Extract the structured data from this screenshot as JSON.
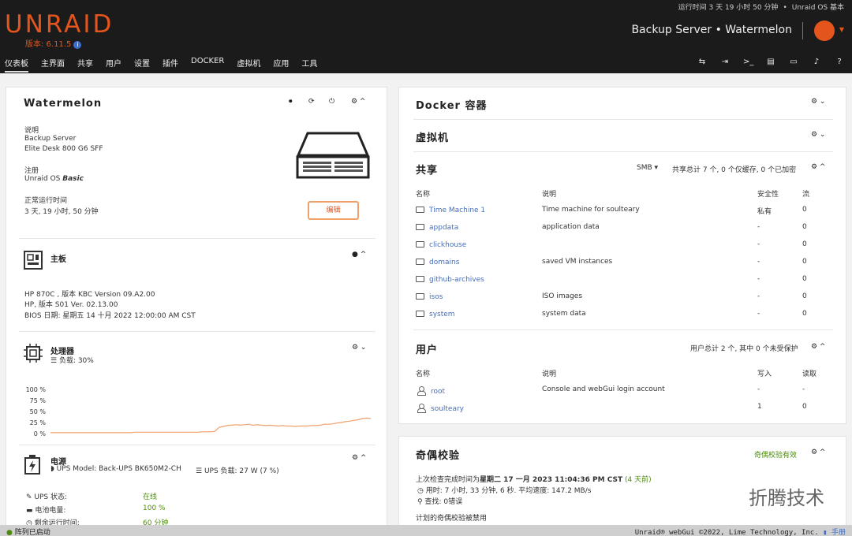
{
  "header": {
    "logo": "UNRAID",
    "version": "版本: 6.11.5",
    "uptime_top": "运行时间 3 天 19 小时 50 分钟",
    "license_top": "Unraid OS 基本",
    "server_title": "Backup Server • Watermelon"
  },
  "nav": {
    "items": [
      "仪表板",
      "主界面",
      "共享",
      "用户",
      "设置",
      "插件",
      "DOCKER",
      "虚拟机",
      "应用",
      "工具"
    ]
  },
  "server_panel": {
    "title": "Watermelon",
    "desc_label": "说明",
    "desc_line1": "Backup Server",
    "desc_line2": "Elite Desk 800 G6 SFF",
    "reg_label": "注册",
    "reg_value_prefix": "Unraid OS ",
    "reg_value_em": "Basic",
    "uptime_label": "正常运行时间",
    "uptime_value": "3 天, 19 小时, 50 分钟",
    "edit_button": "编辑"
  },
  "motherboard": {
    "title": "主板",
    "line1": "HP 870C , 版本 KBC Version 09.A2.00",
    "line2": "HP, 版本 S01 Ver. 02.13.00",
    "line3": "BIOS 日期: 星期五 14 十月 2022 12:00:00 AM CST"
  },
  "cpu": {
    "title": "处理器",
    "load": "负载: 30%",
    "ticks": [
      "100 %",
      "75 %",
      "50 %",
      "25 %",
      "0 %"
    ]
  },
  "chart_data": {
    "type": "line",
    "title": "",
    "ylim": [
      0,
      100
    ],
    "ticks": [
      0,
      25,
      50,
      75,
      100
    ],
    "series": [
      {
        "values": [
          2,
          2,
          2,
          2,
          2,
          2,
          2,
          2,
          2,
          2,
          2,
          2,
          2,
          2,
          2,
          2,
          2,
          2,
          2,
          2,
          3,
          3,
          3,
          3,
          3,
          3,
          3,
          3,
          3,
          3,
          3,
          3,
          3,
          3,
          3,
          3,
          4,
          4,
          4,
          5,
          14,
          16,
          18,
          19,
          20,
          19,
          20,
          21,
          19,
          20,
          19,
          18,
          19,
          18,
          17,
          18,
          17,
          17,
          16,
          17,
          17,
          17,
          18,
          18,
          19,
          21,
          21,
          22,
          24,
          25,
          27,
          28,
          30,
          31,
          34,
          35,
          34
        ]
      }
    ],
    "color": "#f0a06a",
    "grid": false
  },
  "power": {
    "title": "电源",
    "ups_model": "UPS Model: Back-UPS BK650M2-CH",
    "ups_load": "UPS 负载: 27 W (7 %)",
    "rows": [
      {
        "label": "UPS 状态:",
        "value": "在线"
      },
      {
        "label": "电池电量:",
        "value": "100 %"
      },
      {
        "label": "剩余运行时间:",
        "value": "60 分钟"
      }
    ]
  },
  "docker": {
    "title": "Docker 容器"
  },
  "vms": {
    "title": "虚拟机"
  },
  "shares": {
    "title": "共享",
    "filter": "SMB",
    "summary": "共享总计 7 个, 0 个仅缓存, 0 个已加密",
    "columns": [
      "名称",
      "说明",
      "安全性",
      "流"
    ],
    "rows": [
      {
        "name": "Time Machine 1",
        "desc": "Time machine for soulteary",
        "sec": "私有",
        "flow": "0"
      },
      {
        "name": "appdata",
        "desc": "application data",
        "sec": "-",
        "flow": "0"
      },
      {
        "name": "clickhouse",
        "desc": "",
        "sec": "-",
        "flow": "0"
      },
      {
        "name": "domains",
        "desc": "saved VM instances",
        "sec": "-",
        "flow": "0"
      },
      {
        "name": "github-archives",
        "desc": "",
        "sec": "-",
        "flow": "0"
      },
      {
        "name": "isos",
        "desc": "ISO images",
        "sec": "-",
        "flow": "0"
      },
      {
        "name": "system",
        "desc": "system data",
        "sec": "-",
        "flow": "0"
      }
    ]
  },
  "users": {
    "title": "用户",
    "summary": "用户总计 2 个, 其中 0 个未受保护",
    "columns": [
      "名称",
      "说明",
      "写入",
      "读取"
    ],
    "rows": [
      {
        "name": "root",
        "desc": "Console and webGui login account",
        "write": "-",
        "read": "-"
      },
      {
        "name": "soulteary",
        "desc": "",
        "write": "1",
        "read": "0"
      }
    ]
  },
  "parity": {
    "title": "奇偶校验",
    "status": "奇偶校验有效",
    "last_check_prefix": "上次检查完成时间为",
    "last_check_date": "星期二 17 一月 2023 11:04:36 PM CST",
    "last_check_ago": "(4 天前)",
    "duration": "用时: 7 小时, 33 分钟, 6 秒. 平均速度: 147.2 MB/s",
    "errors": "查找: 0错误",
    "scheduled": "计划的奇偶校验被禁用"
  },
  "footer": {
    "array_status": "阵列已启动",
    "copyright": "Unraid® webGui ©2022, Lime Technology, Inc.",
    "manual": "手册"
  },
  "watermark": "折腾技术"
}
